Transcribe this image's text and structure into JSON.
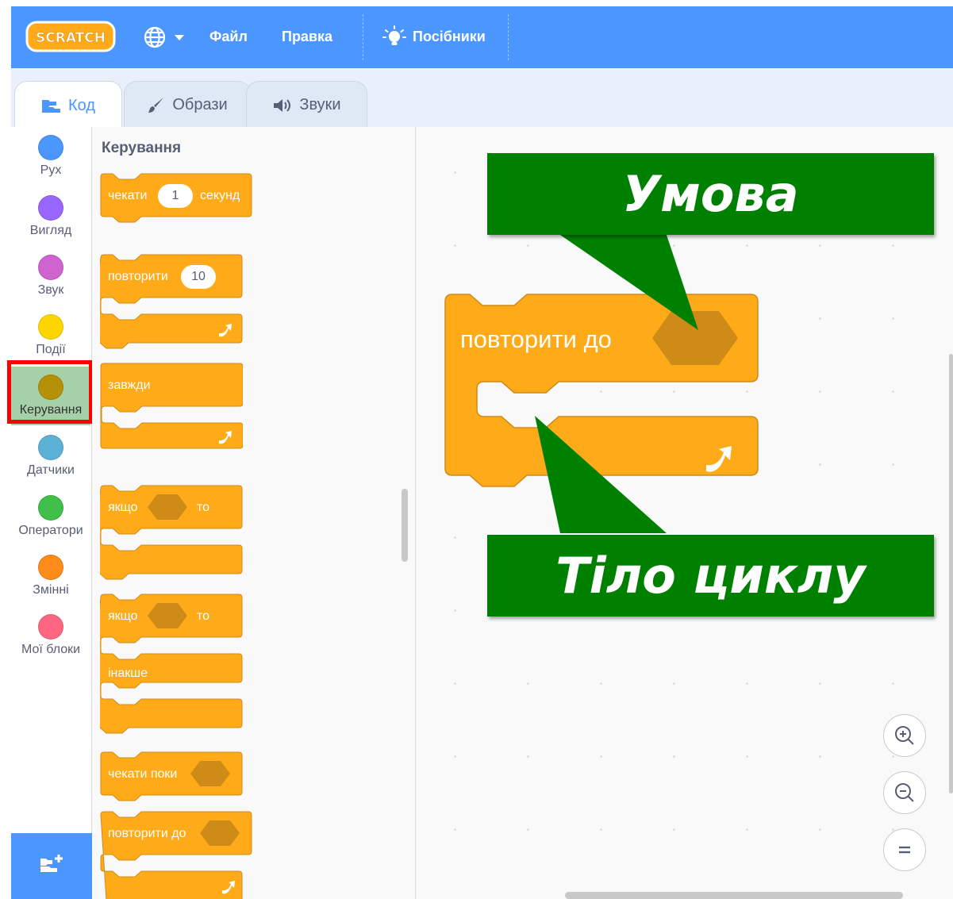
{
  "app": {
    "logo_text": "SCRATCH"
  },
  "menubar": {
    "file": "Файл",
    "edit": "Правка",
    "tutorials": "Посібники"
  },
  "tabs": [
    {
      "label": "Код",
      "icon": "code-blocks-icon",
      "active": true
    },
    {
      "label": "Образи",
      "icon": "paintbrush-icon",
      "active": false
    },
    {
      "label": "Звуки",
      "icon": "speaker-icon",
      "active": false
    }
  ],
  "categories": [
    {
      "label": "Рух",
      "color": "#4c97ff"
    },
    {
      "label": "Вигляд",
      "color": "#9966ff"
    },
    {
      "label": "Звук",
      "color": "#cf63cf"
    },
    {
      "label": "Події",
      "color": "#ffd500"
    },
    {
      "label": "Керування",
      "color": "#b49108",
      "selected": true
    },
    {
      "label": "Датчики",
      "color": "#5cb1d6"
    },
    {
      "label": "Оператори",
      "color": "#40bf4a"
    },
    {
      "label": "Змінні",
      "color": "#ff8c1a"
    },
    {
      "label": "Мої блоки",
      "color": "#ff6680"
    }
  ],
  "palette": {
    "title": "Керування",
    "wait": {
      "text": "чекати",
      "value": "1",
      "unit": "секунд"
    },
    "repeat": {
      "text": "повторити",
      "value": "10"
    },
    "forever": {
      "text": "завжди"
    },
    "if_then": {
      "if": "якщо",
      "then": "то"
    },
    "if_else": {
      "if": "якщо",
      "then": "то",
      "else": "інакше"
    },
    "wait_until": {
      "text": "чекати поки"
    },
    "repeat_until": {
      "text": "повторити до"
    }
  },
  "workspace": {
    "block_text": "повторити до",
    "callout_condition": "Умова",
    "callout_body": "Тіло циклу"
  },
  "colors": {
    "menubar": "#4c97ff",
    "control_block": "#ffab19",
    "control_block_border": "#cf8b17",
    "callout": "#008000",
    "selection_outline": "#ff0000"
  }
}
